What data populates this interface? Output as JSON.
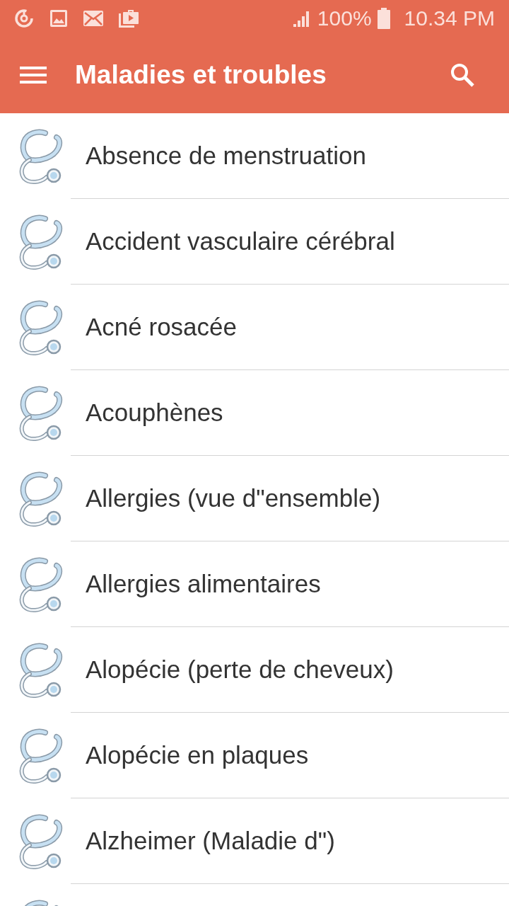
{
  "status_bar": {
    "battery": "100%",
    "time": "10.34 PM"
  },
  "app_bar": {
    "title": "Maladies et troubles"
  },
  "list": {
    "items": [
      {
        "label": "Absence de menstruation"
      },
      {
        "label": "Accident vasculaire cérébral"
      },
      {
        "label": "Acné rosacée"
      },
      {
        "label": "Acouphènes"
      },
      {
        "label": "Allergies (vue d\"ensemble)"
      },
      {
        "label": "Allergies alimentaires"
      },
      {
        "label": "Alopécie (perte de cheveux)"
      },
      {
        "label": "Alopécie en plaques"
      },
      {
        "label": "Alzheimer (Maladie d\")"
      }
    ],
    "more_below": true
  }
}
